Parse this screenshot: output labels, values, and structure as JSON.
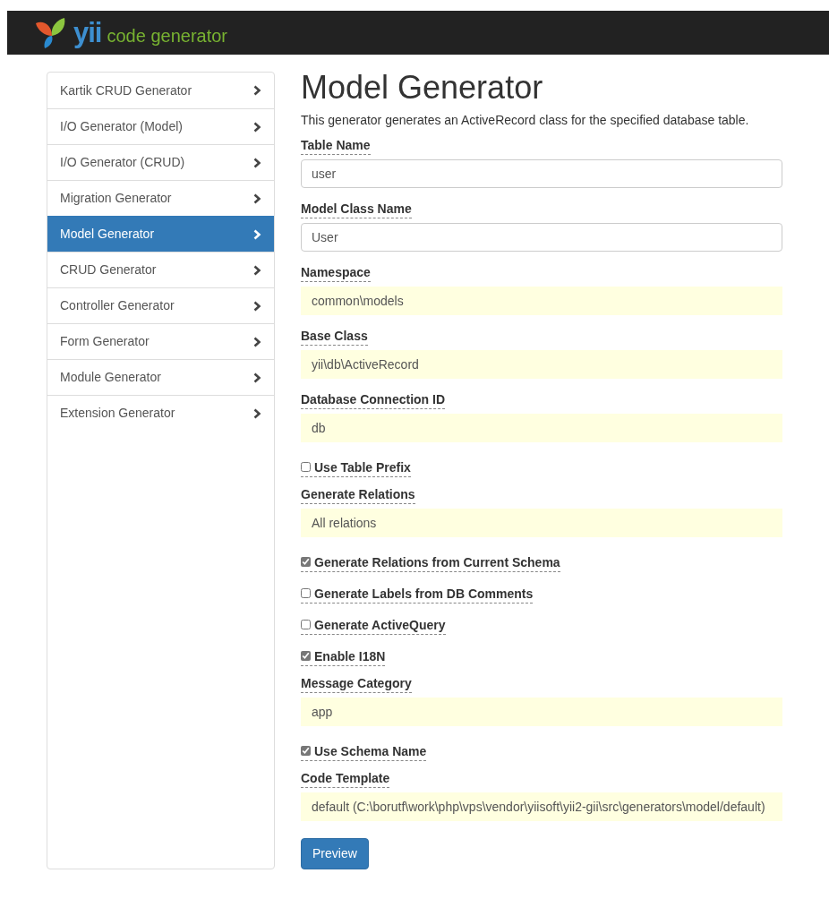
{
  "brand": {
    "mark": "yii",
    "text": "code generator"
  },
  "sidebar": {
    "items": [
      {
        "label": "Kartik CRUD Generator",
        "selected": false
      },
      {
        "label": "I/O Generator (Model)",
        "selected": false
      },
      {
        "label": "I/O Generator (CRUD)",
        "selected": false
      },
      {
        "label": "Migration Generator",
        "selected": false
      },
      {
        "label": "Model Generator",
        "selected": true
      },
      {
        "label": "CRUD Generator",
        "selected": false
      },
      {
        "label": "Controller Generator",
        "selected": false
      },
      {
        "label": "Form Generator",
        "selected": false
      },
      {
        "label": "Module Generator",
        "selected": false
      },
      {
        "label": "Extension Generator",
        "selected": false
      }
    ]
  },
  "title": "Model Generator",
  "description": "This generator generates an ActiveRecord class for the specified database table.",
  "fields": [
    {
      "kind": "text",
      "label": "Table Name",
      "value": "user"
    },
    {
      "kind": "text",
      "label": "Model Class Name",
      "value": "User"
    },
    {
      "kind": "sticky",
      "label": "Namespace",
      "value": "common\\models"
    },
    {
      "kind": "sticky",
      "label": "Base Class",
      "value": "yii\\db\\ActiveRecord"
    },
    {
      "kind": "sticky",
      "label": "Database Connection ID",
      "value": "db"
    },
    {
      "kind": "checkbox",
      "label": "Use Table Prefix",
      "checked": false
    },
    {
      "kind": "sticky",
      "label": "Generate Relations",
      "value": "All relations"
    },
    {
      "kind": "checkbox",
      "label": "Generate Relations from Current Schema",
      "checked": true
    },
    {
      "kind": "checkbox",
      "label": "Generate Labels from DB Comments",
      "checked": false
    },
    {
      "kind": "checkbox",
      "label": "Generate ActiveQuery",
      "checked": false
    },
    {
      "kind": "checkbox",
      "label": "Enable I18N",
      "checked": true
    },
    {
      "kind": "sticky",
      "label": "Message Category",
      "value": "app"
    },
    {
      "kind": "checkbox",
      "label": "Use Schema Name",
      "checked": true
    },
    {
      "kind": "sticky",
      "label": "Code Template",
      "value": "default (C:\\borutf\\work\\php\\vps\\vendor\\yiisoft\\yii2-gii\\src\\generators\\model/default)"
    }
  ],
  "buttons": [
    "Preview"
  ]
}
